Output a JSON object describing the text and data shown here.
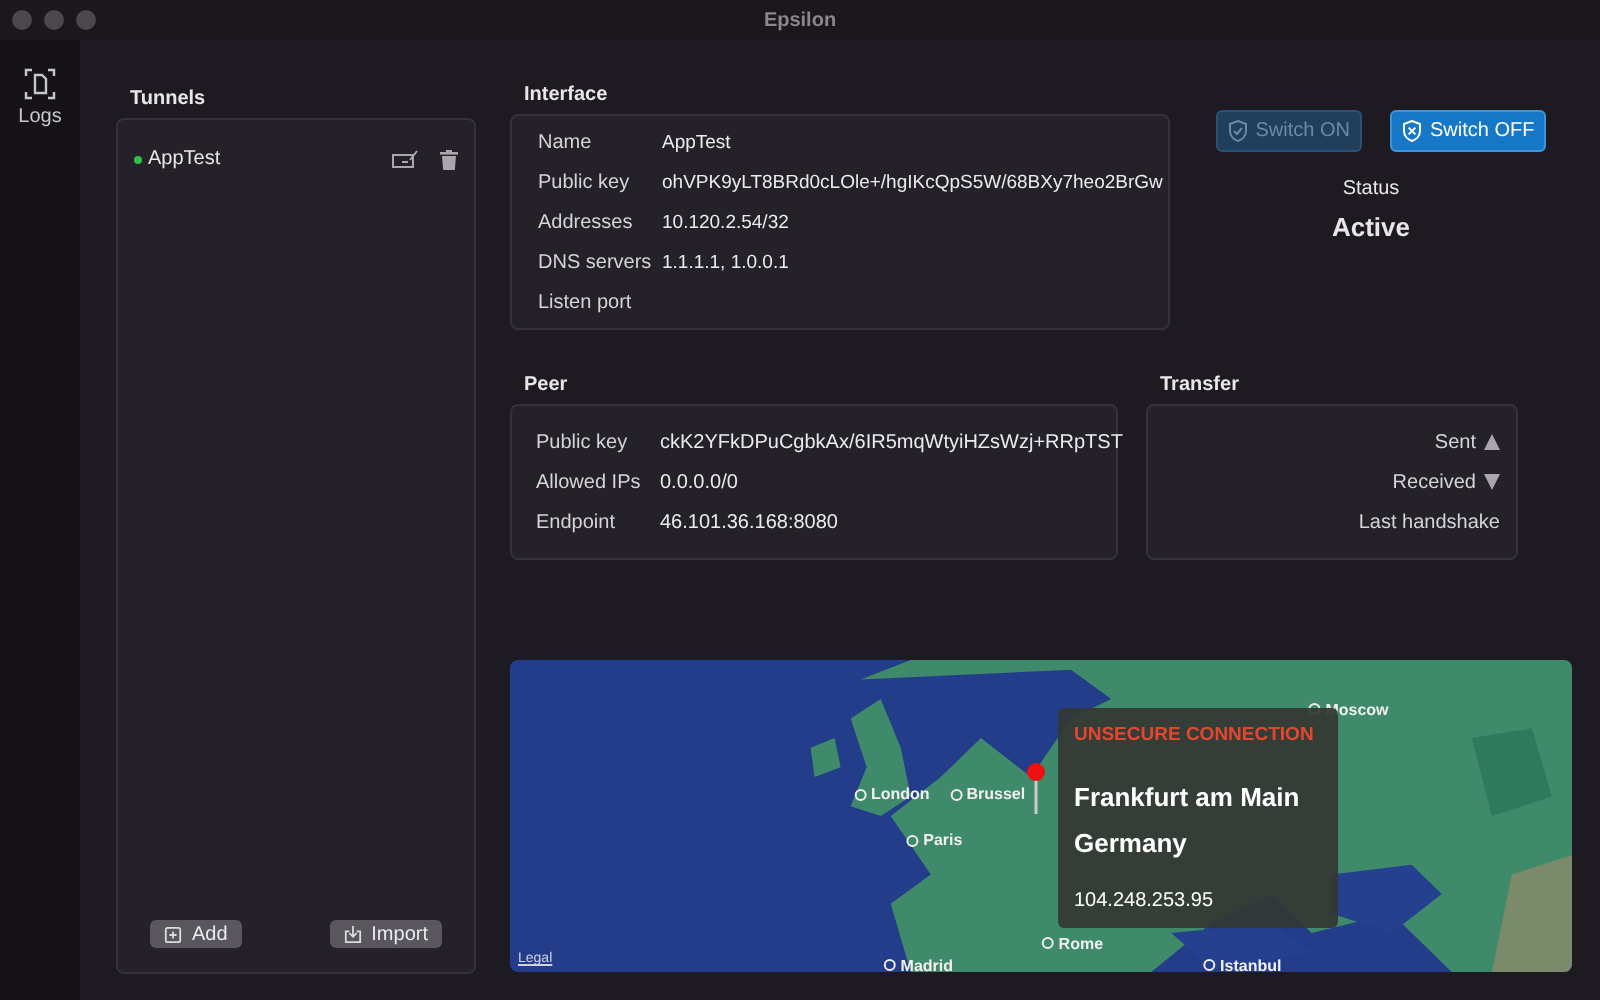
{
  "window": {
    "title": "Epsilon"
  },
  "rail": {
    "items": [
      {
        "label": "Logs",
        "selected": false
      }
    ]
  },
  "tunnels": {
    "title": "Tunnels",
    "items": [
      {
        "name": "AppTest",
        "active": true
      }
    ],
    "buttons": [
      {
        "kind": "add",
        "label": "Add"
      },
      {
        "kind": "import",
        "label": "Import"
      }
    ]
  },
  "interface": {
    "title": "Interface",
    "fields": [
      {
        "label": "Name",
        "value": "AppTest"
      },
      {
        "label": "Public key",
        "value": "ohVPK9yLT8BRd0cLOle+/hgIKcQpS5W/68BXy7heo2BrGw"
      },
      {
        "label": "Addresses",
        "value": "10.120.2.54/32"
      },
      {
        "label": "DNS servers",
        "value": "1.1.1.1, 1.0.0.1"
      },
      {
        "label": "Listen port"
      }
    ]
  },
  "switches": [
    {
      "kind": "on",
      "label": "Switch ON",
      "disabled": true
    },
    {
      "kind": "off",
      "label": "Switch OFF",
      "disabled": false
    }
  ],
  "status": {
    "label": "Status",
    "value": "Active"
  },
  "peer": {
    "title": "Peer",
    "fields": [
      {
        "label": "Public key",
        "value": "ckK2YFkDPuCgbkAx/6IR5mqWtyiHZsWzj+RRpTST"
      },
      {
        "label": "Allowed IPs",
        "value": "0.0.0.0/0"
      },
      {
        "label": "Endpoint",
        "value": "46.101.36.168:8080"
      }
    ]
  },
  "transfer": {
    "title": "Transfer",
    "rows": [
      {
        "label": "Sent",
        "kind": "up"
      },
      {
        "label": "Received",
        "kind": "down"
      },
      {
        "label": "Last handshake"
      }
    ]
  },
  "map": {
    "labels": [
      "Moscow",
      "London",
      "Brussel",
      "Paris",
      "Rome",
      "Madrid",
      "Istanbul"
    ],
    "popup": {
      "warning": "UNSECURE CONNECTION",
      "city": "Frankfurt am Main",
      "country": "Germany",
      "ip": "104.248.253.95"
    },
    "legal": "Legal"
  }
}
